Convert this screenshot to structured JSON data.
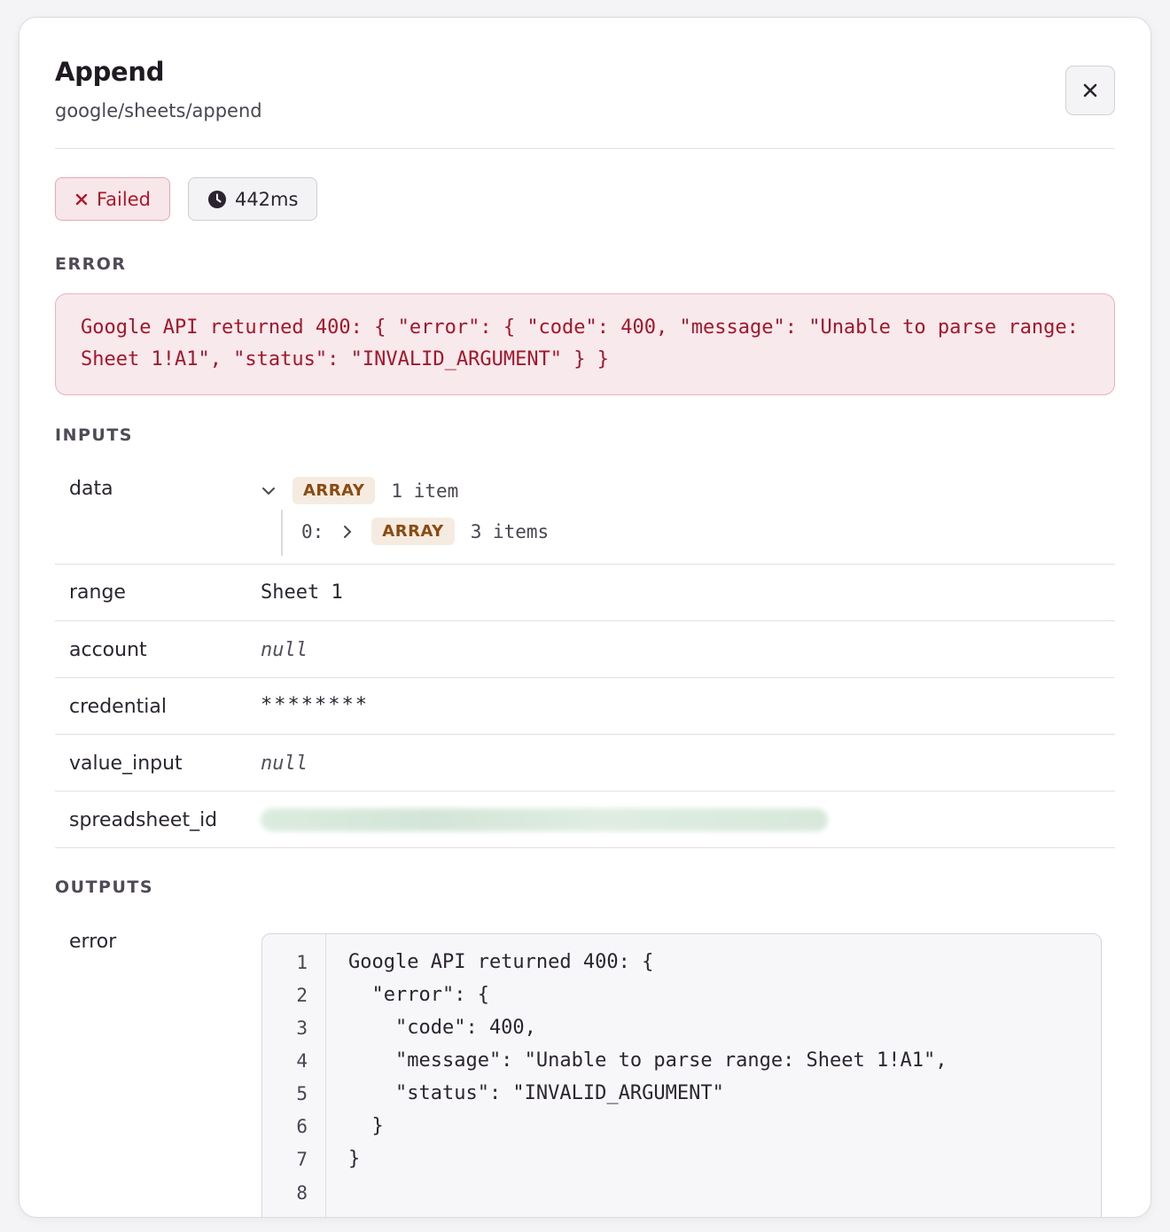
{
  "header": {
    "title": "Append",
    "subtitle": "google/sheets/append",
    "close_icon": "close-icon"
  },
  "status": {
    "failed_label": "Failed",
    "duration_label": "442ms",
    "failed_color": "#b01828"
  },
  "error_section": {
    "label": "ERROR",
    "message": "Google API returned 400: { \"error\": { \"code\": 400, \"message\": \"Unable to parse range: Sheet 1!A1\", \"status\": \"INVALID_ARGUMENT\" } }"
  },
  "inputs": {
    "label": "INPUTS",
    "data": {
      "key": "data",
      "type": "ARRAY",
      "count": "1 item",
      "child_index": "0:",
      "child_type": "ARRAY",
      "child_count": "3 items"
    },
    "range": {
      "key": "range",
      "value": "Sheet 1"
    },
    "account": {
      "key": "account",
      "value": "null"
    },
    "credential": {
      "key": "credential",
      "value": "********"
    },
    "value_input": {
      "key": "value_input",
      "value": "null"
    },
    "spreadsheet_id": {
      "key": "spreadsheet_id"
    }
  },
  "outputs": {
    "label": "OUTPUTS",
    "key": "error",
    "lines": [
      "Google API returned 400: {",
      "  \"error\": {",
      "    \"code\": 400,",
      "    \"message\": \"Unable to parse range: Sheet 1!A1\",",
      "    \"status\": \"INVALID_ARGUMENT\"",
      "  }",
      "}",
      ""
    ],
    "line_numbers": [
      "1",
      "2",
      "3",
      "4",
      "5",
      "6",
      "7",
      "8"
    ]
  }
}
